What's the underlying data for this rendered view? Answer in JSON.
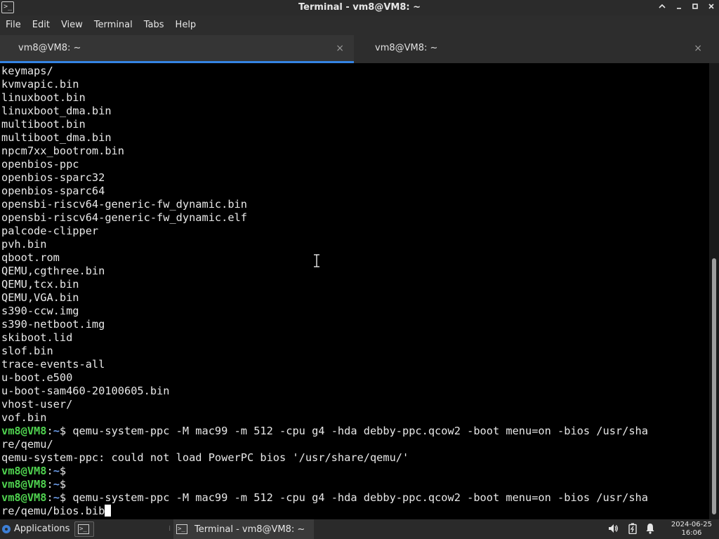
{
  "window": {
    "title": "Terminal - vm8@VM8: ~",
    "app_icon": "terminal-icon",
    "controls": {
      "up": "▲",
      "minimize": "▁",
      "maximize": "□",
      "close": "✕"
    }
  },
  "menubar": {
    "items": [
      "File",
      "Edit",
      "View",
      "Terminal",
      "Tabs",
      "Help"
    ]
  },
  "tabs": [
    {
      "label": "vm8@VM8: ~",
      "active": true,
      "close": "×"
    },
    {
      "label": "vm8@VM8: ~",
      "active": false,
      "close": "×"
    }
  ],
  "terminal": {
    "output_lines": [
      "keymaps/",
      "kvmvapic.bin",
      "linuxboot.bin",
      "linuxboot_dma.bin",
      "multiboot.bin",
      "multiboot_dma.bin",
      "npcm7xx_bootrom.bin",
      "openbios-ppc",
      "openbios-sparc32",
      "openbios-sparc64",
      "opensbi-riscv64-generic-fw_dynamic.bin",
      "opensbi-riscv64-generic-fw_dynamic.elf",
      "palcode-clipper",
      "pvh.bin",
      "qboot.rom",
      "QEMU,cgthree.bin",
      "QEMU,tcx.bin",
      "QEMU,VGA.bin",
      "s390-ccw.img",
      "s390-netboot.img",
      "skiboot.lid",
      "slof.bin",
      "trace-events-all",
      "u-boot.e500",
      "u-boot-sam460-20100605.bin",
      "vhost-user/",
      "vof.bin"
    ],
    "prompt_user": "vm8@VM8",
    "prompt_colon": ":",
    "prompt_path": "~",
    "prompt_symbol": "$ ",
    "cmd1_line1": "qemu-system-ppc -M mac99 -m 512 -cpu g4 -hda debby-ppc.qcow2 -boot menu=on -bios /usr/sha",
    "cmd1_line2": "re/qemu/",
    "error_line": "qemu-system-ppc: could not load PowerPC bios '/usr/share/qemu/'",
    "cmd2_line1": "qemu-system-ppc -M mac99 -m 512 -cpu g4 -hda debby-ppc.qcow2 -boot menu=on -bios /usr/sha",
    "cmd2_line2": "re/qemu/bios.bib"
  },
  "taskbar": {
    "applications_label": "Applications",
    "task_label": "Terminal - vm8@VM8: ~",
    "tray_icons": [
      "speaker-icon",
      "battery-icon",
      "bell-icon"
    ],
    "date": "2024-06-25",
    "time": "16:06"
  },
  "colors": {
    "prompt_user": "#4fd14f",
    "prompt_path": "#6b9be8",
    "active_tab_underline": "#3584e4"
  }
}
